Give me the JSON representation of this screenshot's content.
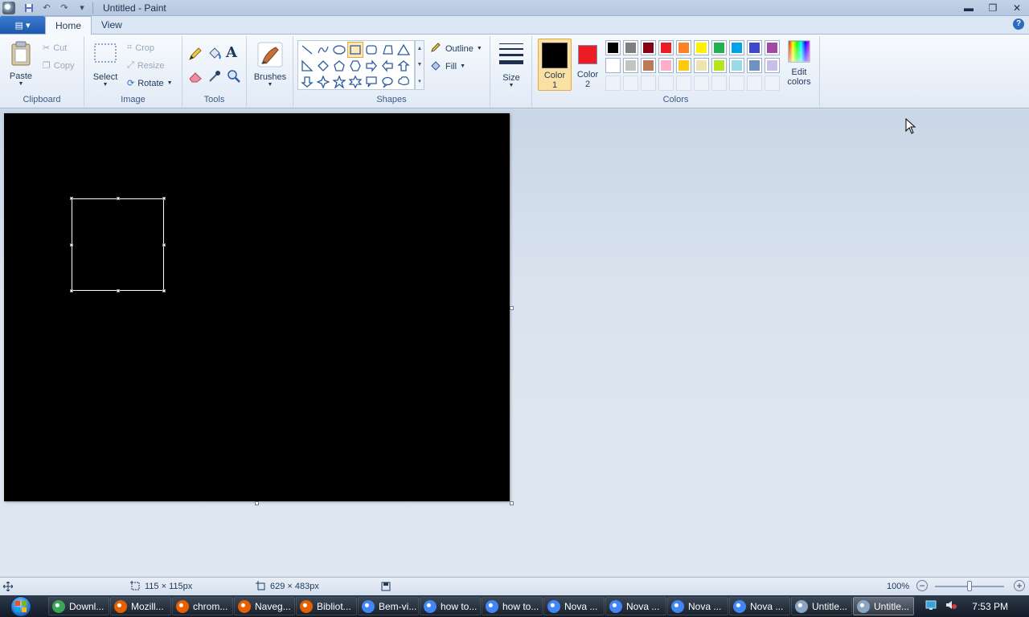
{
  "window": {
    "title": "Untitled - Paint",
    "controls": {
      "minimize": "▬",
      "restore": "❐",
      "close": "✕"
    }
  },
  "quick_access": [
    "save-icon",
    "undo-icon",
    "redo-icon",
    "customize-icon"
  ],
  "tabs": {
    "menu_button": "▤ ▾",
    "home": "Home",
    "view": "View",
    "help": "?"
  },
  "ribbon": {
    "clipboard": {
      "label": "Clipboard",
      "paste": "Paste",
      "cut": "Cut",
      "copy": "Copy"
    },
    "image": {
      "label": "Image",
      "select": "Select",
      "crop": "Crop",
      "resize": "Resize",
      "rotate": "Rotate"
    },
    "tools": {
      "label": "Tools"
    },
    "brushes": {
      "label": "Brushes"
    },
    "shapes": {
      "label": "Shapes",
      "outline": "Outline",
      "fill": "Fill"
    },
    "size": {
      "label": "Size"
    },
    "colors": {
      "label": "Colors",
      "color1_label": "Color",
      "color1_num": "1",
      "color2_label": "Color",
      "color2_num": "2",
      "color1_value": "#000000",
      "color2_value": "#ed1c24",
      "edit_label": "Edit",
      "edit_label2": "colors",
      "palette_row1": [
        "#000000",
        "#7f7f7f",
        "#880015",
        "#ed1c24",
        "#ff7f27",
        "#fff200",
        "#22b14c",
        "#00a2e8",
        "#3f48cc",
        "#a349a4"
      ],
      "palette_row2": [
        "#ffffff",
        "#c3c3c3",
        "#b97a57",
        "#ffaec9",
        "#ffc90e",
        "#efe4b0",
        "#b5e61d",
        "#99d9ea",
        "#7092be",
        "#c8bfe7"
      ],
      "palette_row3": [
        "",
        "",
        "",
        "",
        "",
        "",
        "",
        "",
        "",
        ""
      ]
    }
  },
  "status": {
    "selection_size": "115 × 115px",
    "canvas_size": "629 × 483px",
    "zoom": "100%",
    "zoom_value": 1.0
  },
  "taskbar": {
    "items": [
      {
        "label": "Downl...",
        "color": "#3aa655"
      },
      {
        "label": "Mozill...",
        "color": "#e66000"
      },
      {
        "label": "chrom...",
        "color": "#e66000"
      },
      {
        "label": "Naveg...",
        "color": "#e66000"
      },
      {
        "label": "Bibliot...",
        "color": "#e66000"
      },
      {
        "label": "Bem-vi...",
        "color": "#4285f4"
      },
      {
        "label": "how to...",
        "color": "#4285f4"
      },
      {
        "label": "how to...",
        "color": "#4285f4"
      },
      {
        "label": "Nova ...",
        "color": "#4285f4"
      },
      {
        "label": "Nova ...",
        "color": "#4285f4"
      },
      {
        "label": "Nova ...",
        "color": "#4285f4"
      },
      {
        "label": "Nova ...",
        "color": "#4285f4"
      },
      {
        "label": "Untitle...",
        "color": "#8aa4c4"
      },
      {
        "label": "Untitle...",
        "color": "#8aa4c4"
      }
    ],
    "clock": "7:53 PM"
  }
}
